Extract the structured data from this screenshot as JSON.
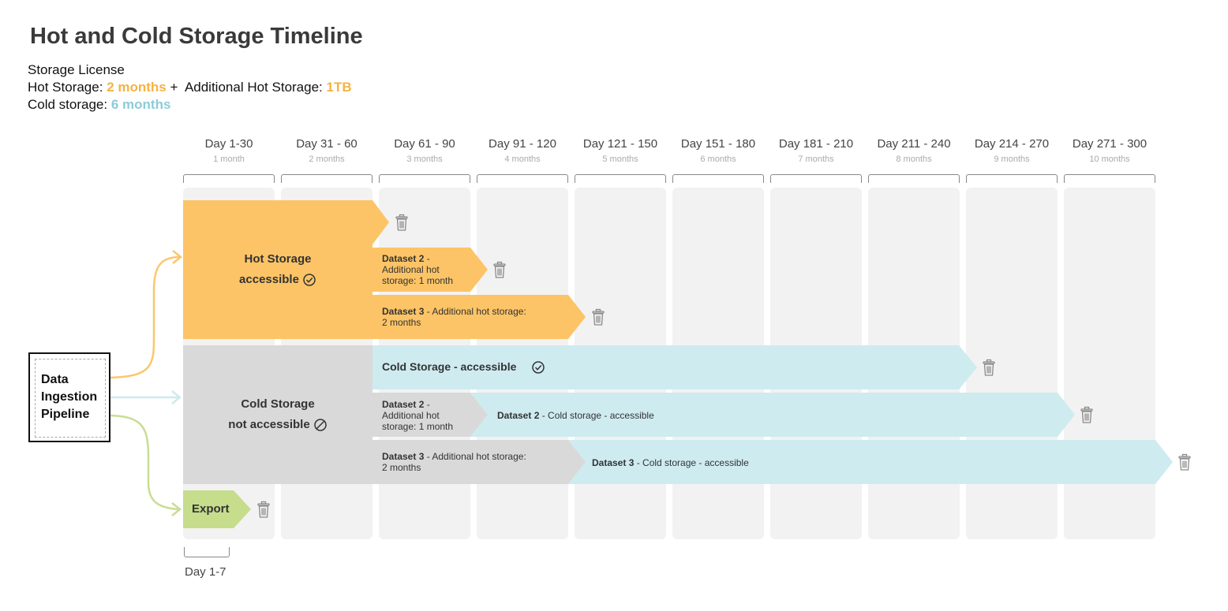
{
  "title": "Hot and Cold Storage Timeline",
  "license": {
    "heading": "Storage License",
    "hot_label": "Hot Storage:",
    "hot_value": "2 months",
    "plus": "+",
    "additional_label": "Additional Hot Storage:",
    "additional_value": "1TB",
    "cold_label": "Cold storage:",
    "cold_value": "6 months"
  },
  "columns": [
    {
      "day": "Day 1-30",
      "month": "1 month"
    },
    {
      "day": "Day 31 - 60",
      "month": "2 months"
    },
    {
      "day": "Day 61 - 90",
      "month": "3 months"
    },
    {
      "day": "Day 91 - 120",
      "month": "4 months"
    },
    {
      "day": "Day 121 - 150",
      "month": "5 months"
    },
    {
      "day": "Day 151 - 180",
      "month": "6 months"
    },
    {
      "day": "Day 181 - 210",
      "month": "7 months"
    },
    {
      "day": "Day 211 - 240",
      "month": "8 months"
    },
    {
      "day": "Day 214 - 270",
      "month": "9 months"
    },
    {
      "day": "Day 271 - 300",
      "month": "10 months"
    }
  ],
  "hot_block": {
    "line1": "Hot Storage",
    "line2": "accessible"
  },
  "cold_block": {
    "line1": "Cold Storage",
    "line2": "not accessible"
  },
  "bars": {
    "d2_hot_bold": "Dataset 2",
    "d2_hot_rest_a": " -",
    "d2_hot_rest_b": "Additional hot",
    "d2_hot_rest_c": "storage: 1 month",
    "d3_hot_bold": "Dataset 3",
    "d3_hot_rest_a": " - Additional hot storage:",
    "d3_hot_rest_b": "2 months",
    "cold_main_bold": "Cold Storage -  accessible",
    "d2_coldgray_bold": "Dataset 2",
    "d2_coldgray_a": " -",
    "d2_coldgray_b": "Additional hot",
    "d2_coldgray_c": "storage: 1 month",
    "d2_cold_bold": "Dataset 2",
    "d2_cold_rest": " - Cold storage - accessible",
    "d3_coldgray_bold": "Dataset 3",
    "d3_coldgray_a": " - Additional hot storage:",
    "d3_coldgray_b": "2 months",
    "d3_cold_bold": "Dataset 3",
    "d3_cold_rest": " - Cold storage - accessible"
  },
  "pipeline": {
    "line1": "Data",
    "line2": "Ingestion",
    "line3": "Pipeline"
  },
  "export": {
    "label": "Export",
    "caption": "Day 1-7"
  },
  "colors": {
    "hot": "#fcc466",
    "cold_accessible": "#ceebf0",
    "cold_inaccessible": "#d9d9d9",
    "export": "#c6dd8c",
    "column_bg": "#f2f2f2",
    "arrow_orange": "#fbc76b",
    "arrow_blue": "#cfe9ef",
    "arrow_green": "#c9dd93"
  },
  "icons": {
    "delete": "trash-icon",
    "accessible": "check-circle-icon",
    "not_accessible": "prohibited-icon"
  }
}
